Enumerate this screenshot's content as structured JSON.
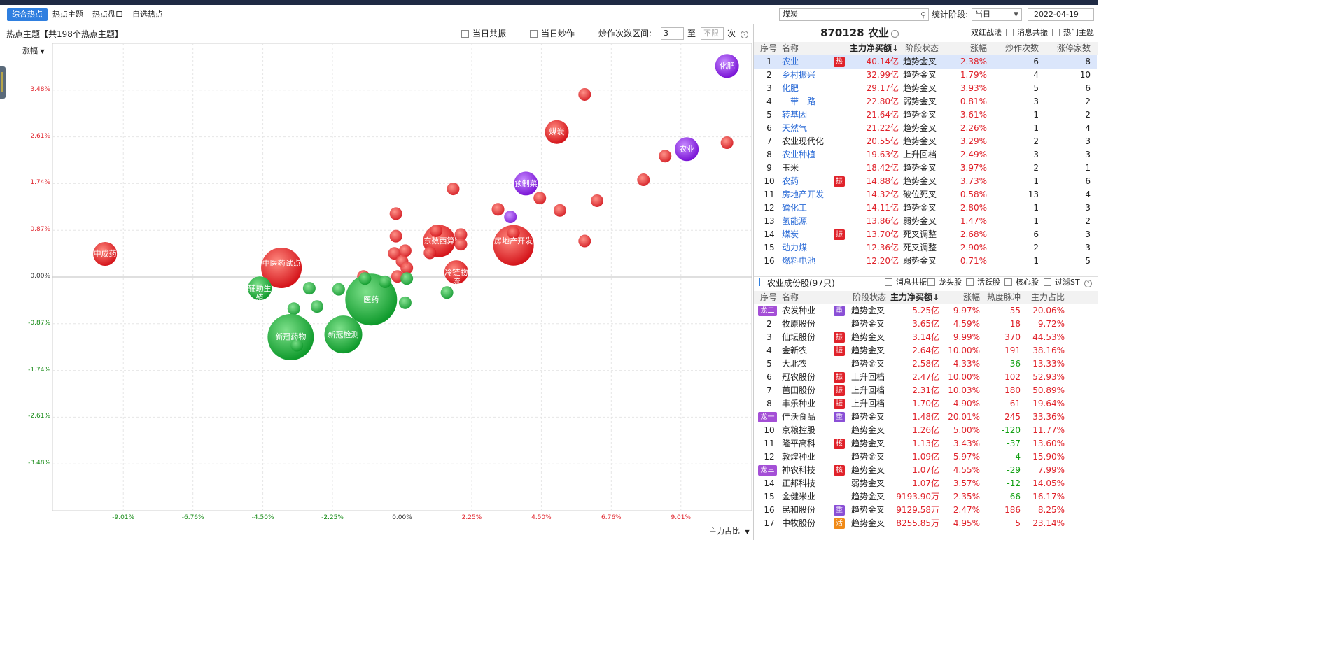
{
  "subnav": {
    "tabs": [
      "综合热点",
      "热点主题",
      "热点盘口",
      "自选热点"
    ],
    "search_value": "煤炭",
    "period_label": "统计阶段:",
    "period_value": "当日",
    "date": "2022-04-19"
  },
  "chart_panel": {
    "title": "热点主题【共198个热点主题】",
    "checkbox_resonance": "当日共振",
    "checkbox_hype": "当日炒作",
    "range_label": "炒作次数区间:",
    "range_from": "3",
    "range_to_label": "至",
    "range_to_placeholder": "不限",
    "range_unit": "次",
    "y_axis_selector": "涨幅",
    "x_axis_selector": "主力占比"
  },
  "chart_data": {
    "type": "scatter",
    "ylabel": "涨幅",
    "xlabel": "主力占比",
    "y_ticks": [
      "3.48%",
      "2.61%",
      "1.74%",
      "0.87%",
      "0.00%",
      "-0.87%",
      "-1.74%",
      "-2.61%",
      "-3.48%"
    ],
    "x_ticks": [
      "-9.01%",
      "-6.76%",
      "-4.50%",
      "-2.25%",
      "0.00%",
      "2.25%",
      "4.50%",
      "6.76%",
      "9.01%"
    ],
    "xlim": [
      -11.3,
      11.3
    ],
    "ylim": [
      -4.35,
      4.35
    ],
    "colors": {
      "up": "#e02828",
      "down": "#1aa83a",
      "selected": "#8a28d8"
    },
    "points": [
      {
        "x": 10.5,
        "y": 3.93,
        "size": 17,
        "color": "purple",
        "label": "化肥"
      },
      {
        "x": 5.9,
        "y": 3.4,
        "size": 9,
        "color": "red",
        "label": ""
      },
      {
        "x": 5.0,
        "y": 2.7,
        "size": 17,
        "color": "red",
        "label": "煤炭"
      },
      {
        "x": 9.2,
        "y": 2.38,
        "size": 17,
        "color": "purple",
        "label": "农业"
      },
      {
        "x": 10.5,
        "y": 2.5,
        "size": 9,
        "color": "red",
        "label": ""
      },
      {
        "x": 8.5,
        "y": 2.25,
        "size": 9,
        "color": "red",
        "label": ""
      },
      {
        "x": 7.8,
        "y": 1.81,
        "size": 9,
        "color": "red",
        "label": ""
      },
      {
        "x": 4.0,
        "y": 1.74,
        "size": 17,
        "color": "purple",
        "label": "预制菜"
      },
      {
        "x": 1.65,
        "y": 1.64,
        "size": 9,
        "color": "red",
        "label": ""
      },
      {
        "x": 4.45,
        "y": 1.47,
        "size": 9,
        "color": "red",
        "label": ""
      },
      {
        "x": 6.3,
        "y": 1.42,
        "size": 9,
        "color": "red",
        "label": ""
      },
      {
        "x": 3.1,
        "y": 1.26,
        "size": 9,
        "color": "red",
        "label": ""
      },
      {
        "x": 5.1,
        "y": 1.24,
        "size": 9,
        "color": "red",
        "label": ""
      },
      {
        "x": 3.5,
        "y": 1.12,
        "size": 9,
        "color": "purple",
        "label": ""
      },
      {
        "x": -0.2,
        "y": 1.18,
        "size": 9,
        "color": "red",
        "label": ""
      },
      {
        "x": 1.2,
        "y": 0.67,
        "size": 23,
        "color": "red",
        "label": "东数西算"
      },
      {
        "x": 1.1,
        "y": 0.86,
        "size": 9,
        "color": "red",
        "label": ""
      },
      {
        "x": 1.9,
        "y": 0.79,
        "size": 9,
        "color": "red",
        "label": ""
      },
      {
        "x": 1.9,
        "y": 0.61,
        "size": 9,
        "color": "red",
        "label": ""
      },
      {
        "x": 0.9,
        "y": 0.45,
        "size": 9,
        "color": "red",
        "label": ""
      },
      {
        "x": 3.6,
        "y": 0.59,
        "size": 29,
        "color": "red",
        "label": "房地产开发"
      },
      {
        "x": 3.6,
        "y": 0.82,
        "size": 9,
        "color": "red",
        "label": ""
      },
      {
        "x": 5.9,
        "y": 0.67,
        "size": 9,
        "color": "red",
        "label": ""
      },
      {
        "x": -0.2,
        "y": 0.76,
        "size": 9,
        "color": "red",
        "label": ""
      },
      {
        "x": -0.25,
        "y": 0.44,
        "size": 9,
        "color": "red",
        "label": ""
      },
      {
        "x": 0.1,
        "y": 0.49,
        "size": 9,
        "color": "red",
        "label": ""
      },
      {
        "x": 0.0,
        "y": 0.29,
        "size": 9,
        "color": "red",
        "label": ""
      },
      {
        "x": 0.15,
        "y": 0.17,
        "size": 9,
        "color": "red",
        "label": ""
      },
      {
        "x": -0.15,
        "y": 0.01,
        "size": 9,
        "color": "red",
        "label": ""
      },
      {
        "x": -1.25,
        "y": 0.01,
        "size": 9,
        "color": "red",
        "label": ""
      },
      {
        "x": 1.75,
        "y": 0.09,
        "size": 17,
        "color": "red",
        "label": "冷链物流"
      },
      {
        "x": -9.6,
        "y": 0.43,
        "size": 17,
        "color": "red",
        "label": "中成药"
      },
      {
        "x": -3.9,
        "y": 0.17,
        "size": 29,
        "color": "red",
        "label": "中医药试点"
      },
      {
        "x": -4.6,
        "y": -0.21,
        "size": 17,
        "color": "green",
        "label": "辅助生殖"
      },
      {
        "x": -3.0,
        "y": -0.21,
        "size": 9,
        "color": "green",
        "label": ""
      },
      {
        "x": -2.05,
        "y": -0.23,
        "size": 9,
        "color": "green",
        "label": ""
      },
      {
        "x": -1.0,
        "y": -0.42,
        "size": 37,
        "color": "green",
        "label": "医药"
      },
      {
        "x": -1.2,
        "y": -0.03,
        "size": 9,
        "color": "green",
        "label": ""
      },
      {
        "x": -0.55,
        "y": -0.09,
        "size": 9,
        "color": "green",
        "label": ""
      },
      {
        "x": 0.15,
        "y": -0.03,
        "size": 9,
        "color": "green",
        "label": ""
      },
      {
        "x": 0.1,
        "y": -0.48,
        "size": 9,
        "color": "green",
        "label": ""
      },
      {
        "x": 1.45,
        "y": -0.29,
        "size": 9,
        "color": "green",
        "label": ""
      },
      {
        "x": -3.5,
        "y": -0.59,
        "size": 9,
        "color": "green",
        "label": ""
      },
      {
        "x": -2.75,
        "y": -0.55,
        "size": 9,
        "color": "green",
        "label": ""
      },
      {
        "x": -3.6,
        "y": -1.12,
        "size": 33,
        "color": "green",
        "label": "新冠药物"
      },
      {
        "x": -1.9,
        "y": -1.07,
        "size": 27,
        "color": "green",
        "label": "新冠检测"
      },
      {
        "x": -3.4,
        "y": -1.27,
        "size": 9,
        "color": "green",
        "label": ""
      }
    ]
  },
  "right_panel": {
    "title": "870128 农业",
    "checkboxes": [
      "双红战法",
      "消息共振",
      "热门主题"
    ],
    "table1": {
      "headers": [
        "序号",
        "名称",
        "主力净买额↓",
        "阶段状态",
        "涨幅",
        "炒作次数",
        "涨停家数"
      ],
      "rows": [
        {
          "no": "1",
          "name": "农业",
          "tag": "热",
          "amount": "40.14亿",
          "state": "趋势金叉",
          "chg": "2.38%",
          "times": "6",
          "limit": "8",
          "link": true
        },
        {
          "no": "2",
          "name": "乡村振兴",
          "tag": "",
          "amount": "32.99亿",
          "state": "趋势金叉",
          "chg": "1.79%",
          "times": "4",
          "limit": "10",
          "link": true
        },
        {
          "no": "3",
          "name": "化肥",
          "tag": "",
          "amount": "29.17亿",
          "state": "趋势金叉",
          "chg": "3.93%",
          "times": "5",
          "limit": "6",
          "link": true
        },
        {
          "no": "4",
          "name": "一带一路",
          "tag": "",
          "amount": "22.80亿",
          "state": "弱势金叉",
          "chg": "0.81%",
          "times": "3",
          "limit": "2",
          "link": true
        },
        {
          "no": "5",
          "name": "转基因",
          "tag": "",
          "amount": "21.64亿",
          "state": "趋势金叉",
          "chg": "3.61%",
          "times": "1",
          "limit": "2",
          "link": true
        },
        {
          "no": "6",
          "name": "天然气",
          "tag": "",
          "amount": "21.22亿",
          "state": "趋势金叉",
          "chg": "2.26%",
          "times": "1",
          "limit": "4",
          "link": true
        },
        {
          "no": "7",
          "name": "农业现代化",
          "tag": "",
          "amount": "20.55亿",
          "state": "趋势金叉",
          "chg": "3.29%",
          "times": "2",
          "limit": "3",
          "link": false
        },
        {
          "no": "8",
          "name": "农业种植",
          "tag": "",
          "amount": "19.63亿",
          "state": "上升回档",
          "chg": "2.49%",
          "times": "3",
          "limit": "3",
          "link": true
        },
        {
          "no": "9",
          "name": "玉米",
          "tag": "",
          "amount": "18.42亿",
          "state": "趋势金叉",
          "chg": "3.97%",
          "times": "2",
          "limit": "1",
          "link": false
        },
        {
          "no": "10",
          "name": "农药",
          "tag": "振",
          "amount": "14.88亿",
          "state": "趋势金叉",
          "chg": "3.73%",
          "times": "1",
          "limit": "6",
          "link": true
        },
        {
          "no": "11",
          "name": "房地产开发",
          "tag": "",
          "amount": "14.32亿",
          "state": "破位死叉",
          "chg": "0.58%",
          "times": "13",
          "limit": "4",
          "link": true
        },
        {
          "no": "12",
          "name": "磷化工",
          "tag": "",
          "amount": "14.11亿",
          "state": "趋势金叉",
          "chg": "2.80%",
          "times": "1",
          "limit": "3",
          "link": true
        },
        {
          "no": "13",
          "name": "氢能源",
          "tag": "",
          "amount": "13.86亿",
          "state": "弱势金叉",
          "chg": "1.47%",
          "times": "1",
          "limit": "2",
          "link": true
        },
        {
          "no": "14",
          "name": "煤炭",
          "tag": "振",
          "amount": "13.70亿",
          "state": "死叉调整",
          "chg": "2.68%",
          "times": "6",
          "limit": "3",
          "link": true
        },
        {
          "no": "15",
          "name": "动力煤",
          "tag": "",
          "amount": "12.36亿",
          "state": "死叉调整",
          "chg": "2.90%",
          "times": "2",
          "limit": "3",
          "link": true
        },
        {
          "no": "16",
          "name": "燃料电池",
          "tag": "",
          "amount": "12.20亿",
          "state": "弱势金叉",
          "chg": "0.71%",
          "times": "1",
          "limit": "5",
          "link": true
        }
      ]
    },
    "section2": {
      "title": "农业成份股(97只)",
      "checkboxes": [
        "消息共振",
        "龙头股",
        "活跃股",
        "核心股",
        "过滤ST"
      ]
    },
    "table2": {
      "headers": [
        "序号",
        "名称",
        "阶段状态",
        "主力净买额↓",
        "涨幅",
        "热度脉冲",
        "主力占比"
      ],
      "rows": [
        {
          "no": "龙二",
          "name": "农发种业",
          "tag": "重",
          "state": "趋势金叉",
          "amount": "5.25亿",
          "chg": "9.97%",
          "heat": "55",
          "ratio": "20.06%"
        },
        {
          "no": "2",
          "name": "牧原股份",
          "tag": "",
          "state": "趋势金叉",
          "amount": "3.65亿",
          "chg": "4.59%",
          "heat": "18",
          "ratio": "9.72%"
        },
        {
          "no": "3",
          "name": "仙坛股份",
          "tag": "振",
          "state": "趋势金叉",
          "amount": "3.14亿",
          "chg": "9.99%",
          "heat": "370",
          "ratio": "44.53%"
        },
        {
          "no": "4",
          "name": "金新农",
          "tag": "振",
          "state": "趋势金叉",
          "amount": "2.64亿",
          "chg": "10.00%",
          "heat": "191",
          "ratio": "38.16%"
        },
        {
          "no": "5",
          "name": "大北农",
          "tag": "",
          "state": "趋势金叉",
          "amount": "2.58亿",
          "chg": "4.33%",
          "heat": "-36",
          "ratio": "13.33%"
        },
        {
          "no": "6",
          "name": "冠农股份",
          "tag": "振",
          "state": "上升回档",
          "amount": "2.47亿",
          "chg": "10.00%",
          "heat": "102",
          "ratio": "52.93%"
        },
        {
          "no": "7",
          "name": "芭田股份",
          "tag": "振",
          "state": "上升回档",
          "amount": "2.31亿",
          "chg": "10.03%",
          "heat": "180",
          "ratio": "50.89%"
        },
        {
          "no": "8",
          "name": "丰乐种业",
          "tag": "振",
          "state": "上升回档",
          "amount": "1.70亿",
          "chg": "4.90%",
          "heat": "61",
          "ratio": "19.64%"
        },
        {
          "no": "龙一",
          "name": "佳沃食品",
          "tag": "重",
          "state": "趋势金叉",
          "amount": "1.48亿",
          "chg": "20.01%",
          "heat": "245",
          "ratio": "33.36%"
        },
        {
          "no": "10",
          "name": "京粮控股",
          "tag": "",
          "state": "趋势金叉",
          "amount": "1.26亿",
          "chg": "5.00%",
          "heat": "-120",
          "ratio": "11.77%"
        },
        {
          "no": "11",
          "name": "隆平高科",
          "tag": "核",
          "state": "趋势金叉",
          "amount": "1.13亿",
          "chg": "3.43%",
          "heat": "-37",
          "ratio": "13.60%"
        },
        {
          "no": "12",
          "name": "敦煌种业",
          "tag": "",
          "state": "趋势金叉",
          "amount": "1.09亿",
          "chg": "5.97%",
          "heat": "-4",
          "ratio": "15.90%"
        },
        {
          "no": "龙三",
          "name": "神农科技",
          "tag": "核",
          "state": "趋势金叉",
          "amount": "1.07亿",
          "chg": "4.55%",
          "heat": "-29",
          "ratio": "7.99%"
        },
        {
          "no": "14",
          "name": "正邦科技",
          "tag": "",
          "state": "弱势金叉",
          "amount": "1.07亿",
          "chg": "3.57%",
          "heat": "-12",
          "ratio": "14.05%"
        },
        {
          "no": "15",
          "name": "金健米业",
          "tag": "",
          "state": "趋势金叉",
          "amount": "9193.90万",
          "chg": "2.35%",
          "heat": "-66",
          "ratio": "16.17%"
        },
        {
          "no": "16",
          "name": "民和股份",
          "tag": "重",
          "state": "趋势金叉",
          "amount": "9129.58万",
          "chg": "2.47%",
          "heat": "186",
          "ratio": "8.25%"
        },
        {
          "no": "17",
          "name": "中牧股份",
          "tag": "活",
          "state": "趋势金叉",
          "amount": "8255.85万",
          "chg": "4.95%",
          "heat": "5",
          "ratio": "23.14%"
        }
      ]
    }
  }
}
